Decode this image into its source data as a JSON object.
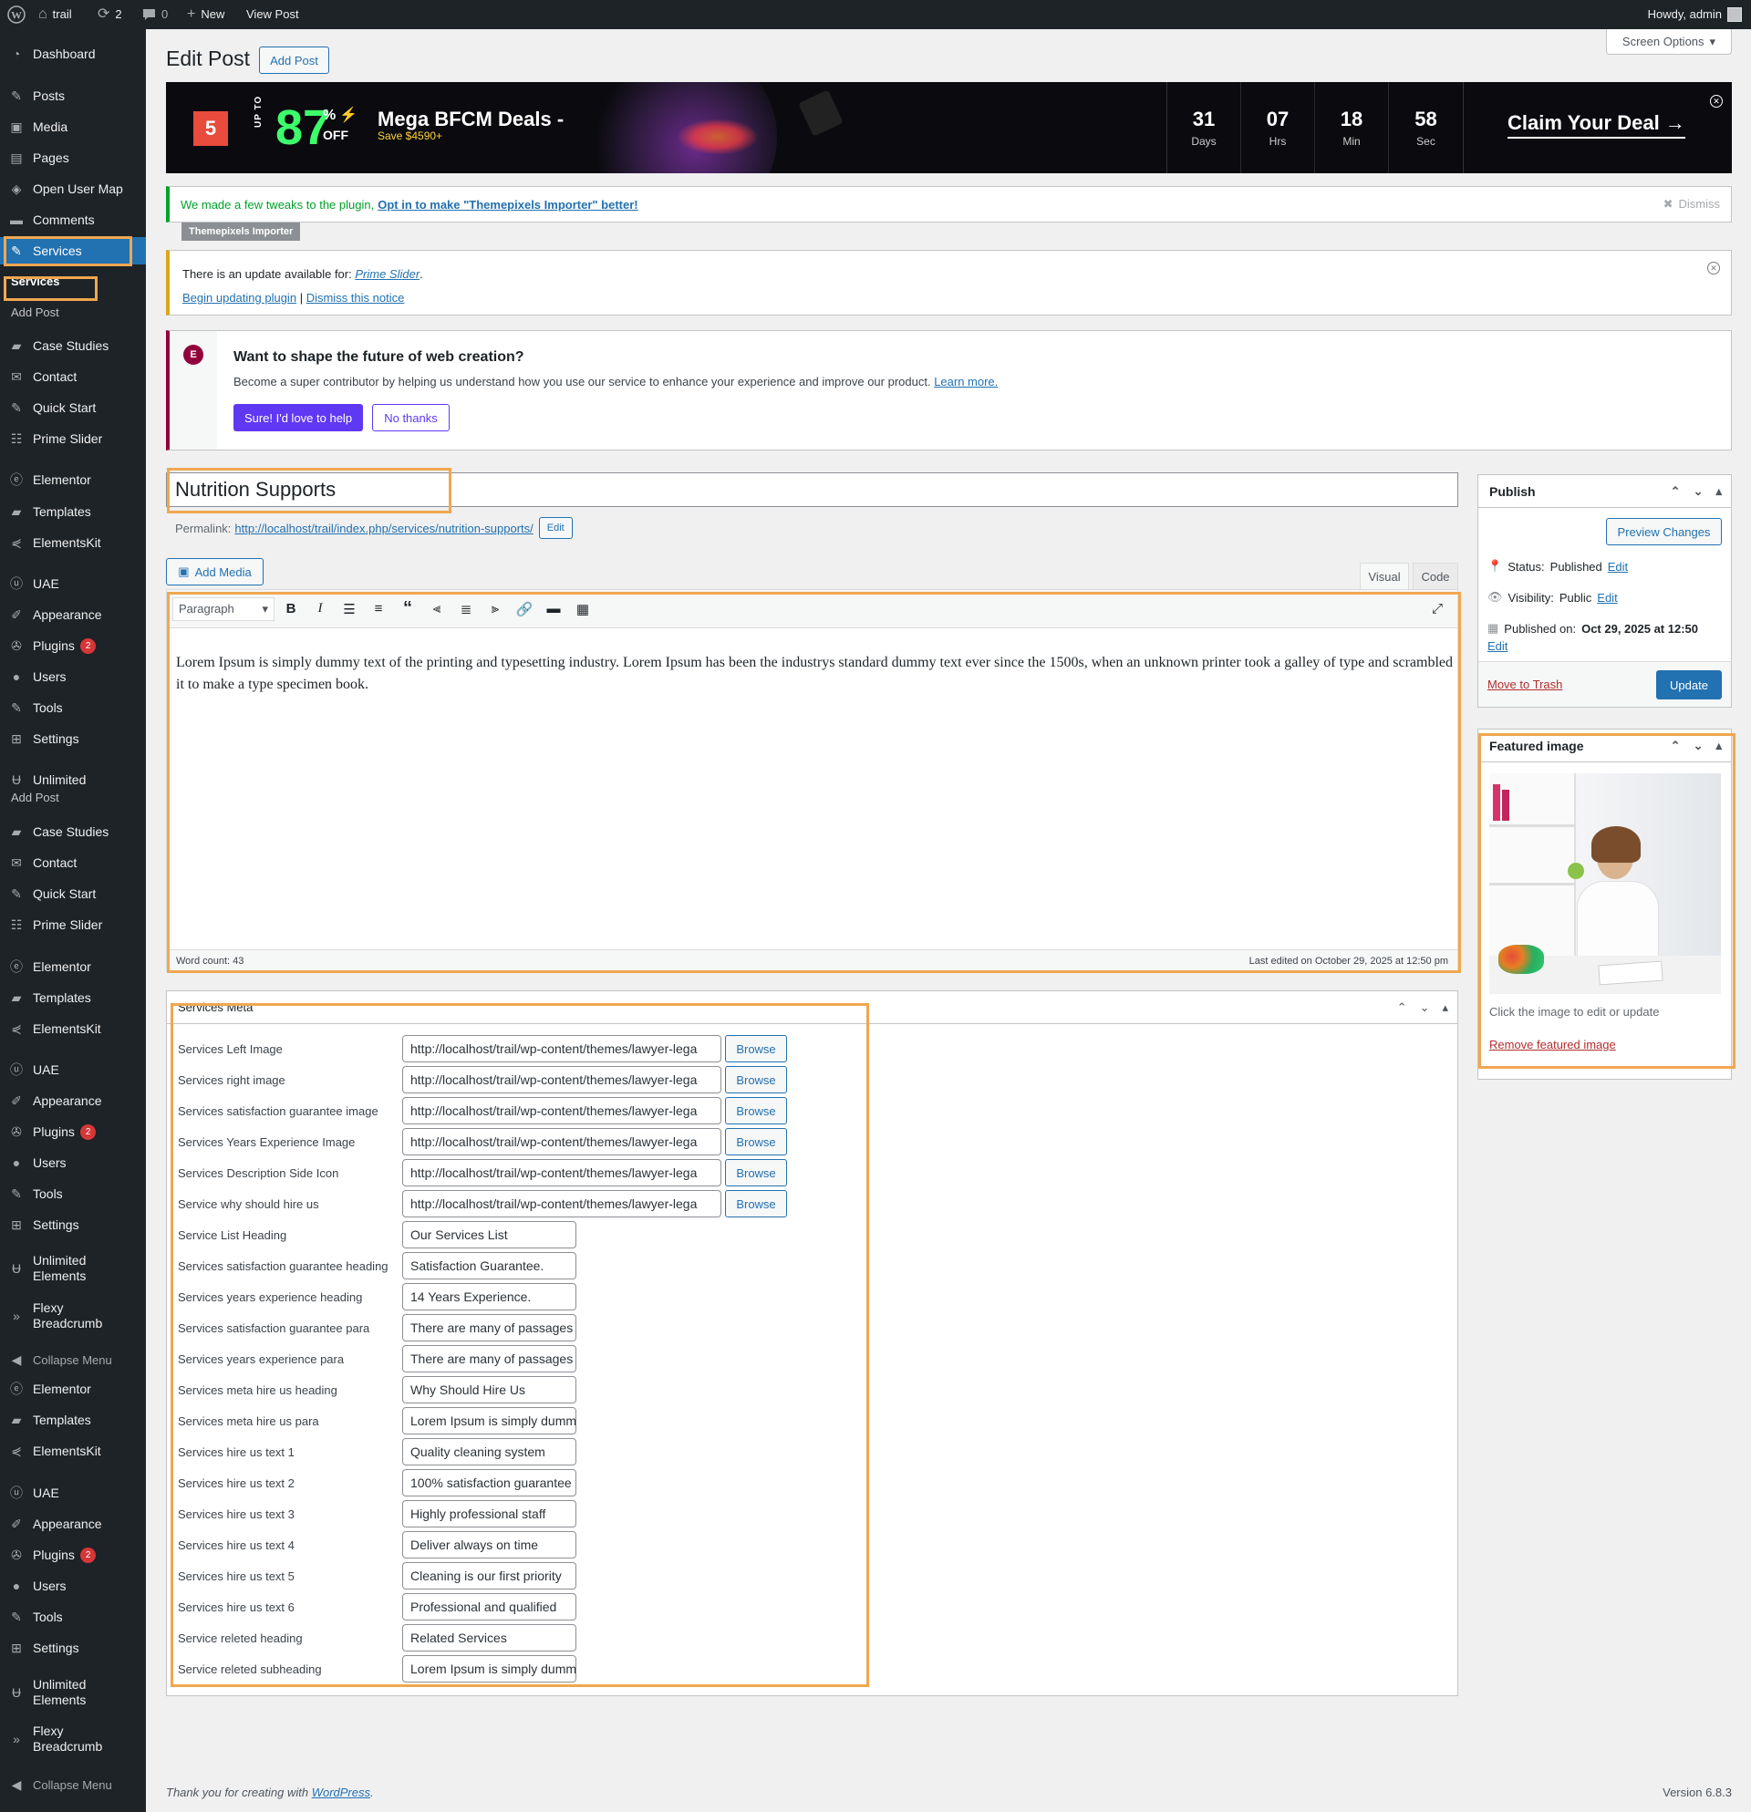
{
  "admin_bar": {
    "site_name": "trail",
    "updates_count": "2",
    "comments_count": "0",
    "new_label": "New",
    "view_post_label": "View Post",
    "howdy": "Howdy, admin"
  },
  "sidebar": {
    "block1": [
      {
        "label": "Dashboard",
        "icon": "dashboard-icon"
      },
      {
        "label": "Posts",
        "icon": "pin-icon"
      },
      {
        "label": "Media",
        "icon": "media-icon"
      },
      {
        "label": "Pages",
        "icon": "pages-icon"
      },
      {
        "label": "Open User Map",
        "icon": "map-icon"
      },
      {
        "label": "Comments",
        "icon": "comments-icon"
      },
      {
        "label": "Services",
        "icon": "wrench-icon"
      }
    ],
    "submenu": {
      "services": "Services",
      "add_post": "Add Post"
    },
    "block2": [
      {
        "label": "Case Studies",
        "icon": "folder-icon"
      },
      {
        "label": "Contact",
        "icon": "mail-icon"
      },
      {
        "label": "Quick Start",
        "icon": "wrench-icon"
      },
      {
        "label": "Prime Slider",
        "icon": "slider-icon"
      },
      {
        "label": "Elementor",
        "icon": "elementor-icon"
      },
      {
        "label": "Templates",
        "icon": "folder-icon"
      },
      {
        "label": "ElementsKit",
        "icon": "ek-icon"
      },
      {
        "label": "UAE",
        "icon": "uae-icon"
      },
      {
        "label": "Appearance",
        "icon": "brush-icon"
      },
      {
        "label": "Plugins",
        "icon": "plugin-icon",
        "badge": "2"
      },
      {
        "label": "Users",
        "icon": "users-icon"
      },
      {
        "label": "Tools",
        "icon": "tools-icon"
      },
      {
        "label": "Settings",
        "icon": "settings-icon"
      },
      {
        "label": "Unlimited",
        "icon": "unlimited-icon"
      }
    ],
    "dup_add_post": "Add Post",
    "block3": [
      {
        "label": "Case Studies",
        "icon": "folder-icon"
      },
      {
        "label": "Contact",
        "icon": "mail-icon"
      },
      {
        "label": "Quick Start",
        "icon": "wrench-icon"
      },
      {
        "label": "Prime Slider",
        "icon": "slider-icon"
      },
      {
        "label": "Elementor",
        "icon": "elementor-icon"
      },
      {
        "label": "Templates",
        "icon": "folder-icon"
      },
      {
        "label": "ElementsKit",
        "icon": "ek-icon"
      },
      {
        "label": "UAE",
        "icon": "uae-icon"
      },
      {
        "label": "Appearance",
        "icon": "brush-icon"
      },
      {
        "label": "Plugins",
        "icon": "plugin-icon",
        "badge": "2"
      },
      {
        "label": "Users",
        "icon": "users-icon"
      },
      {
        "label": "Tools",
        "icon": "tools-icon"
      },
      {
        "label": "Settings",
        "icon": "settings-icon"
      },
      {
        "label": "Unlimited Elements",
        "icon": "unlimited-icon"
      },
      {
        "label": "Flexy Breadcrumb",
        "icon": "breadcrumb-icon"
      },
      {
        "label": "Collapse Menu",
        "icon": "collapse-icon"
      },
      {
        "label": "Elementor",
        "icon": "elementor-icon"
      },
      {
        "label": "Templates",
        "icon": "folder-icon"
      },
      {
        "label": "ElementsKit",
        "icon": "ek-icon"
      },
      {
        "label": "UAE",
        "icon": "uae-icon"
      },
      {
        "label": "Appearance",
        "icon": "brush-icon"
      },
      {
        "label": "Plugins",
        "icon": "plugin-icon",
        "badge": "2"
      },
      {
        "label": "Users",
        "icon": "users-icon"
      },
      {
        "label": "Tools",
        "icon": "tools-icon"
      },
      {
        "label": "Settings",
        "icon": "settings-icon"
      },
      {
        "label": "Unlimited Elements",
        "icon": "unlimited-icon"
      },
      {
        "label": "Flexy Breadcrumb",
        "icon": "breadcrumb-icon"
      },
      {
        "label": "Collapse Menu",
        "icon": "collapse-icon"
      }
    ]
  },
  "header": {
    "title": "Edit Post",
    "add_post": "Add Post",
    "screen_options": "Screen Options"
  },
  "banner": {
    "logo": "5",
    "up_to": "UP TO",
    "percent": "87",
    "percent_sign": "%",
    "off": "OFF",
    "headline": "Mega BFCM Deals -",
    "save": "Save $4590+",
    "countdown": [
      {
        "value": "31",
        "unit": "Days"
      },
      {
        "value": "07",
        "unit": "Hrs"
      },
      {
        "value": "18",
        "unit": "Min"
      },
      {
        "value": "58",
        "unit": "Sec"
      }
    ],
    "cta": "Claim Your Deal →"
  },
  "notices": {
    "themepixels_text": "We made a few tweaks to the plugin,",
    "themepixels_link": "Opt in to make \"Themepixels Importer\" better!",
    "dismiss": "Dismiss",
    "themepixels_tag": "Themepixels Importer",
    "update_text": "There is an update available for:",
    "update_plugin": "Prime Slider",
    "begin_update": "Begin updating plugin",
    "separator": "|",
    "dismiss_notice": "Dismiss this notice",
    "elementor_title": "Want to shape the future of web creation?",
    "elementor_text": "Become a super contributor by helping us understand how you use our service to enhance your experience and improve our product.",
    "learn_more": "Learn more.",
    "sure": "Sure! I'd love to help",
    "no_thanks": "No thanks"
  },
  "post": {
    "title": "Nutrition Supports",
    "permalink_label": "Permalink:",
    "permalink_url": "http://localhost/trail/index.php/services/nutrition-supports/",
    "permalink_edit": "Edit",
    "add_media": "Add Media",
    "tab_visual": "Visual",
    "tab_code": "Code",
    "format": "Paragraph",
    "content": "Lorem Ipsum is simply dummy text of the printing and typesetting industry. Lorem Ipsum has been the industrys standard dummy text ever since the 1500s, when an unknown printer took a galley of type and scrambled it to make a type specimen book.",
    "word_count": "Word count: 43",
    "last_edited": "Last edited on October 29, 2025 at 12:50 pm"
  },
  "services_meta": {
    "title": "Services Meta",
    "browse_label": "Browse",
    "rows": [
      {
        "label": "Services Left Image",
        "value": "http://localhost/trail/wp-content/themes/lawyer-lega",
        "browse": true
      },
      {
        "label": "Services right image",
        "value": "http://localhost/trail/wp-content/themes/lawyer-lega",
        "browse": true
      },
      {
        "label": "Services satisfaction guarantee image",
        "value": "http://localhost/trail/wp-content/themes/lawyer-lega",
        "browse": true
      },
      {
        "label": "Services Years Experience Image",
        "value": "http://localhost/trail/wp-content/themes/lawyer-lega",
        "browse": true
      },
      {
        "label": "Services Description Side Icon",
        "value": "http://localhost/trail/wp-content/themes/lawyer-lega",
        "browse": true
      },
      {
        "label": "Service why should hire us",
        "value": "http://localhost/trail/wp-content/themes/lawyer-lega",
        "browse": true
      },
      {
        "label": "Service List Heading",
        "value": "Our Services List"
      },
      {
        "label": "Services satisfaction guarantee heading",
        "value": "Satisfaction Guarantee."
      },
      {
        "label": "Services years experience heading",
        "value": "14 Years Experience."
      },
      {
        "label": "Services satisfaction guarantee para",
        "value": "There are many of passages"
      },
      {
        "label": "Services years experience para",
        "value": "There are many of passages"
      },
      {
        "label": "Services meta hire us heading",
        "value": "Why Should Hire Us"
      },
      {
        "label": "Services meta hire us para",
        "value": "Lorem Ipsum is simply dummy"
      },
      {
        "label": "Services hire us text 1",
        "value": " Quality cleaning system"
      },
      {
        "label": "Services hire us text 2",
        "value": "100% satisfaction guarantee"
      },
      {
        "label": "Services hire us text 3",
        "value": " Highly professional staff"
      },
      {
        "label": "Services hire us text 4",
        "value": "Deliver always on time"
      },
      {
        "label": "Services hire us text 5",
        "value": "Cleaning is our first priority"
      },
      {
        "label": "Services hire us text 6",
        "value": "Professional and qualified"
      },
      {
        "label": "Service releted heading",
        "value": "Related Services"
      },
      {
        "label": "Service releted subheading",
        "value": "Lorem Ipsum is simply dummy"
      }
    ]
  },
  "publish": {
    "title": "Publish",
    "preview": "Preview Changes",
    "status_label": "Status:",
    "status_value": "Published",
    "visibility_label": "Visibility:",
    "visibility_value": "Public",
    "published_label": "Published on:",
    "published_value": "Oct 29, 2025 at 12:50",
    "edit": "Edit",
    "trash": "Move to Trash",
    "update": "Update"
  },
  "featured": {
    "title": "Featured image",
    "hint": "Click the image to edit or update",
    "remove": "Remove featured image"
  },
  "footer": {
    "thanks": "Thank you for creating with",
    "wp_link": "WordPress",
    "period": ".",
    "version": "Version 6.8.3"
  },
  "colors": {
    "admin_dark": "#1d2327",
    "wp_blue": "#2271b1",
    "highlight": "#f0a750",
    "banner_green": "#3cff6b",
    "elementor_purple": "#5f38f3"
  }
}
